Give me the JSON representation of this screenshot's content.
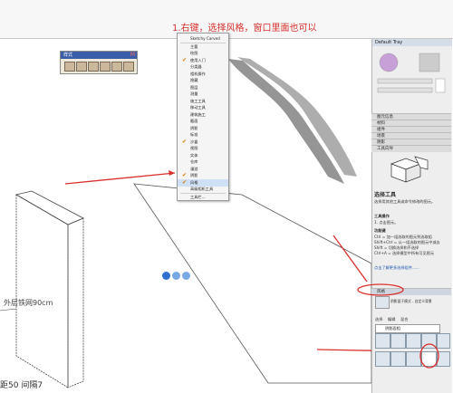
{
  "instruction": "1.右键，选择风格，窗口里面也可以",
  "styles_toolbar": {
    "title": "样式",
    "close_glyph": "M",
    "icons": [
      "xray-icon",
      "wireframe-icon",
      "hidden-line-icon",
      "shaded-icon",
      "textured-icon",
      "monochrome-icon"
    ]
  },
  "context_menu": {
    "items": [
      {
        "label": "Sketchy Carved",
        "checked": false
      },
      {
        "label": "主要",
        "checked": false
      },
      {
        "label": "绘图",
        "checked": false
      },
      {
        "label": "使用入门",
        "checked": true
      },
      {
        "label": "分类器",
        "checked": false
      },
      {
        "label": "相机操作",
        "checked": false
      },
      {
        "label": "隐藏",
        "checked": false
      },
      {
        "label": "图层",
        "checked": false
      },
      {
        "label": "测量",
        "checked": false
      },
      {
        "label": "施工工具",
        "checked": false
      },
      {
        "label": "移动工具",
        "checked": false
      },
      {
        "label": "建筑施工",
        "checked": false
      },
      {
        "label": "截面",
        "checked": false
      },
      {
        "label": "阴影",
        "checked": false
      },
      {
        "label": "标准",
        "checked": false
      },
      {
        "label": "沙盒",
        "checked": true
      },
      {
        "label": "视图",
        "checked": false
      },
      {
        "label": "实体",
        "checked": false
      },
      {
        "label": "仓库",
        "checked": false
      },
      {
        "label": "漫游",
        "checked": false
      },
      {
        "label": "阴影",
        "checked": true
      },
      {
        "label": "风格",
        "checked": true,
        "selected": true
      },
      {
        "label": "高级相机工具",
        "checked": false
      },
      {
        "label": "工具栏...",
        "checked": false
      }
    ]
  },
  "tray": {
    "title": "Default Tray",
    "sections": [
      "图元信息",
      "材料",
      "组件",
      "场景",
      "阴影",
      "工具向导"
    ],
    "style_section": "风格",
    "tool_title": "选择工具",
    "tool_desc": "选择用其他工具或命令修改的图元。",
    "tool_ops_title": "工具操作",
    "tool_ops": "1. 点击图元。",
    "modifier_title": "功能键",
    "modifiers": [
      "Ctrl = 加一组选取的图元到选取组",
      "Shift+Ctrl = 从一组选取的图元中减去",
      "Shift = 切换选择和不选择",
      "Ctrl+A = 选择模型中所有可见图元"
    ],
    "more_link": "点击了解更多选择组件......",
    "style_name": "风格",
    "style_hint": "阴影面于模式 - 自定义背景",
    "tabs": [
      "选择",
      "编辑",
      "混合"
    ],
    "style_dropdown": "阴影面相"
  },
  "status_text": "距50  间隔7",
  "dimension_text": "外层铁网90cm"
}
